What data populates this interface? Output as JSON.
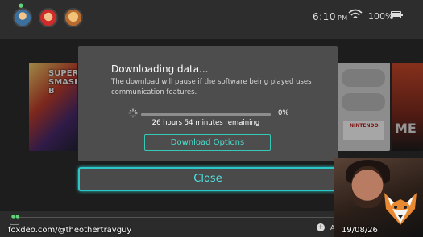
{
  "status_bar": {
    "time": "6:10",
    "meridiem": "PM",
    "battery": "100%"
  },
  "tiles": {
    "smash_title": "SUPER SMASH B",
    "snes_label": "NINTENDO",
    "mm_title": "ME"
  },
  "dialog": {
    "title": "Downloading data...",
    "message": "The download will pause if the software being played uses communication features.",
    "progress_percent": "0%",
    "progress_fraction": 0,
    "remaining": "26 hours 54 minutes remaining",
    "options_button": "Download Options"
  },
  "close_button": "Close",
  "overlay": {
    "watermark": "foxdeo.com/@theothertravguy",
    "date": "19/08/26",
    "a_label": "A"
  },
  "colors": {
    "accent": "#2ad1d6",
    "dialog_bg": "#4d4d4d",
    "background": "#2d2d2d"
  },
  "icons": [
    "wifi-icon",
    "battery-icon",
    "spinner-icon",
    "plus-icon",
    "fox-logo-icon"
  ]
}
